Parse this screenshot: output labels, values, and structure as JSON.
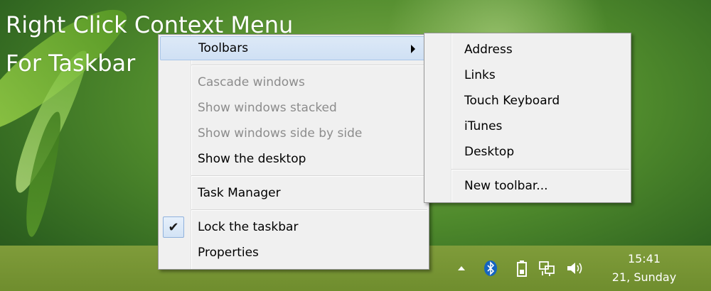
{
  "title": {
    "line1": "Right Click Context Menu",
    "line2": "For Taskbar"
  },
  "context_menu": {
    "items": [
      {
        "label": "Toolbars",
        "state": "highlighted",
        "has_submenu": true
      },
      {
        "label": "Cascade windows",
        "state": "disabled"
      },
      {
        "label": "Show windows stacked",
        "state": "disabled"
      },
      {
        "label": "Show windows side by side",
        "state": "disabled"
      },
      {
        "label": "Show the desktop",
        "state": "enabled"
      },
      {
        "label": "Task Manager",
        "state": "enabled"
      },
      {
        "label": "Lock the taskbar",
        "state": "checked"
      },
      {
        "label": "Properties",
        "state": "enabled"
      }
    ],
    "check_glyph": "✔"
  },
  "toolbars_submenu": {
    "items": [
      {
        "label": "Address"
      },
      {
        "label": "Links"
      },
      {
        "label": "Touch Keyboard"
      },
      {
        "label": "iTunes"
      },
      {
        "label": "Desktop"
      },
      {
        "label": "New toolbar..."
      }
    ]
  },
  "taskbar": {
    "tray_icons": [
      "chevron-up-icon",
      "bluetooth-icon",
      "battery-icon",
      "network-icon",
      "speaker-icon"
    ],
    "clock_time": "15:41",
    "clock_date": "21, Sunday"
  },
  "colors": {
    "menu_bg": "#f0f0f0",
    "highlight": "#cfe0f4",
    "taskbar": "#7f9c3a",
    "disabled_text": "#8c8c8c"
  }
}
